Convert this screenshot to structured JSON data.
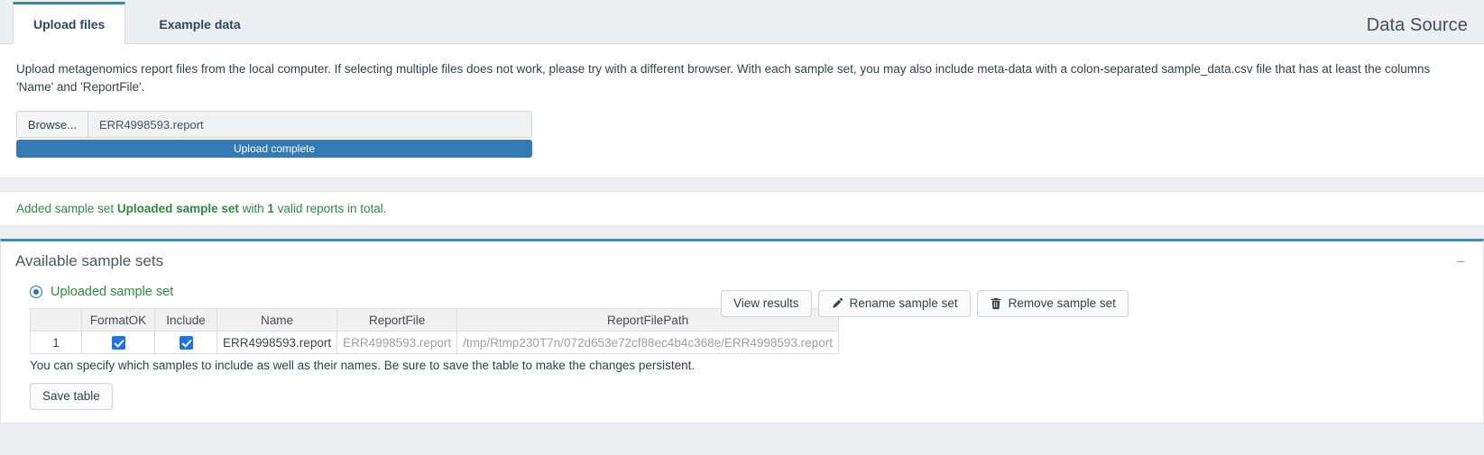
{
  "header": {
    "title": "Data Source",
    "tabs": [
      {
        "label": "Upload files",
        "active": true
      },
      {
        "label": "Example data",
        "active": false
      }
    ]
  },
  "upload": {
    "description": "Upload metagenomics report files from the local computer. If selecting multiple files does not work, please try with a different browser. With each sample set, you may also include meta-data with a colon-separated sample_data.csv file that has at least the columns 'Name' and 'ReportFile'.",
    "browse_label": "Browse...",
    "file_name": "ERR4998593.report",
    "progress_label": "Upload complete",
    "progress_percent": 100
  },
  "status": {
    "prefix": "Added sample set ",
    "set_name": "Uploaded sample set",
    "middle": " with ",
    "count": "1",
    "suffix": " valid reports in total.",
    "color": "#2e8b3d"
  },
  "sample_sets": {
    "card_title": "Available sample sets",
    "collapse_icon": "minus-icon",
    "selected_set": "Uploaded sample set",
    "buttons": [
      {
        "label": "View results",
        "icon": "none"
      },
      {
        "label": "Rename sample set",
        "icon": "pencil-icon"
      },
      {
        "label": "Remove sample set",
        "icon": "trash-icon"
      }
    ],
    "table": {
      "columns": [
        "",
        "FormatOK",
        "Include",
        "Name",
        "ReportFile",
        "ReportFilePath"
      ],
      "rows": [
        {
          "index": "1",
          "format_ok": true,
          "include": true,
          "name": "ERR4998593.report",
          "report_file": "ERR4998593.report",
          "report_file_path": "/tmp/Rtmp230T7n/072d653e72cf88ec4b4c368e/ERR4998593.report"
        }
      ]
    },
    "note": "You can specify which samples to include as well as their names. Be sure to save the table to make the changes persistent.",
    "save_label": "Save table"
  }
}
